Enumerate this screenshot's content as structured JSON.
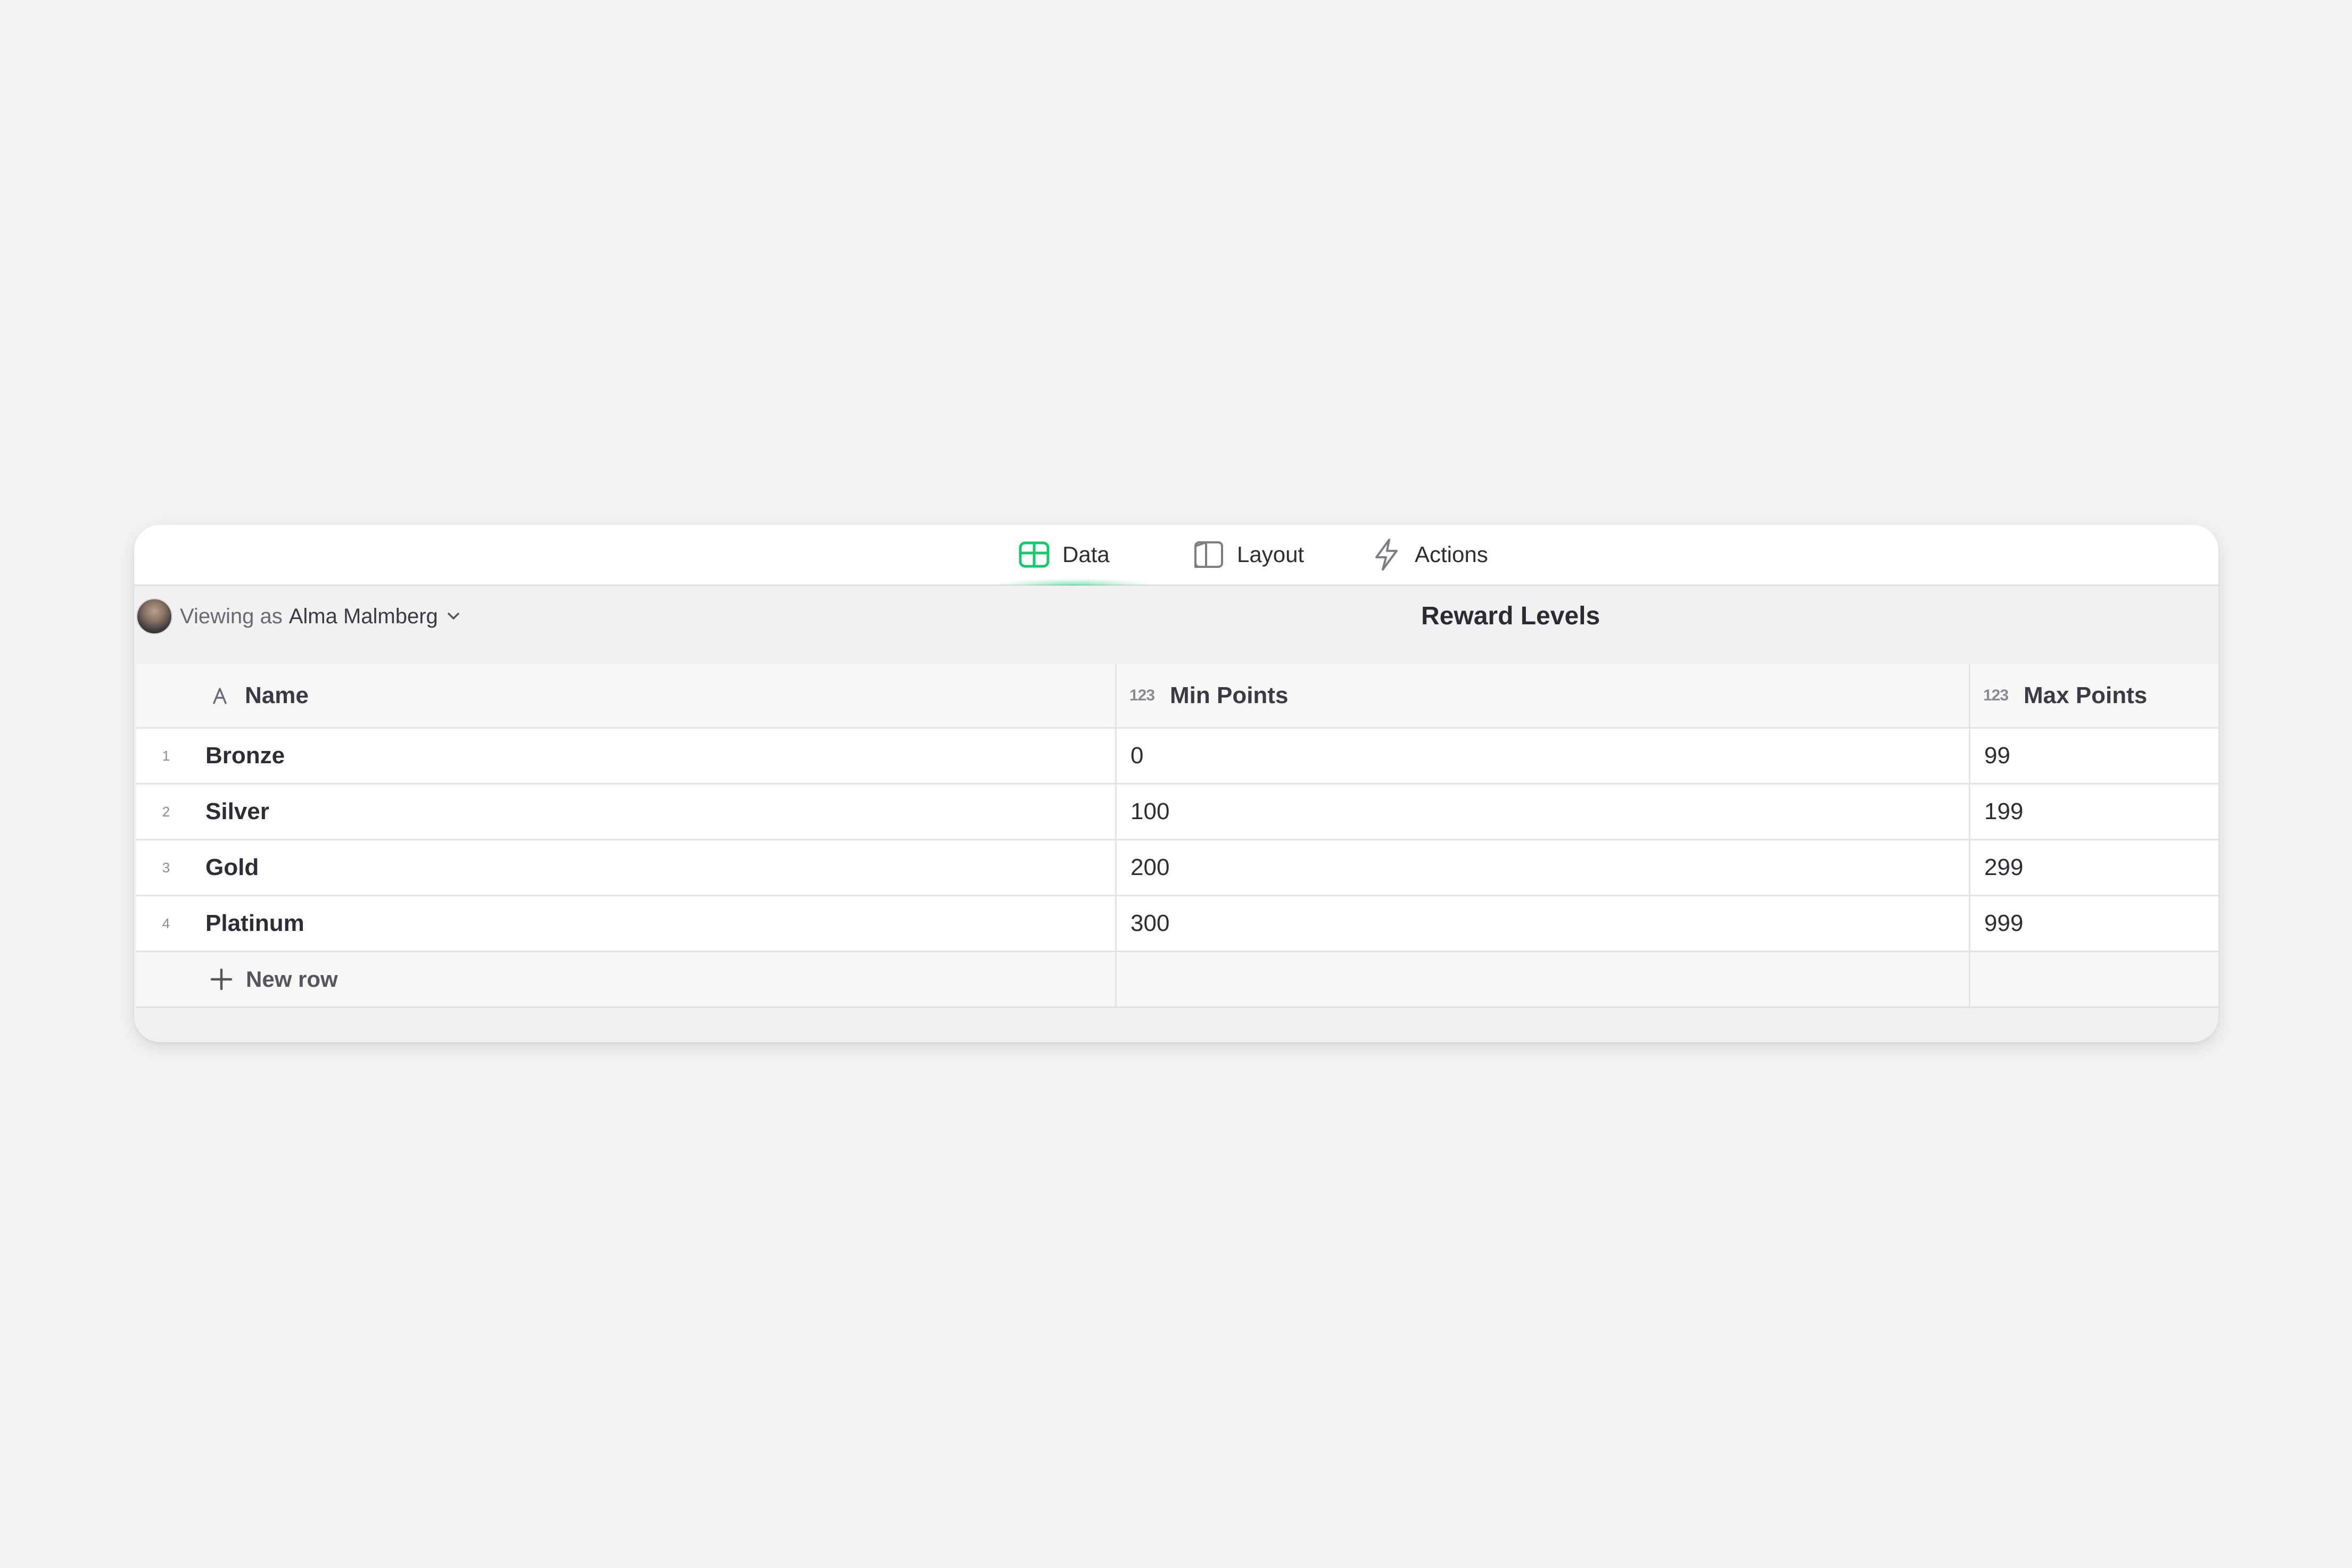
{
  "tabs": [
    {
      "label": "Data",
      "icon": "table-icon",
      "active": true
    },
    {
      "label": "Layout",
      "icon": "layout-icon",
      "active": false
    },
    {
      "label": "Actions",
      "icon": "lightning-icon",
      "active": false
    }
  ],
  "viewer": {
    "prefix": "Viewing as",
    "name": "Alma Malmberg"
  },
  "table": {
    "title": "Reward Levels",
    "columns": [
      {
        "label": "Name",
        "type_icon": "A"
      },
      {
        "label": "Min Points",
        "type_icon": "123"
      },
      {
        "label": "Max Points",
        "type_icon": "123"
      }
    ],
    "rows": [
      {
        "num": "1",
        "name": "Bronze",
        "min": "0",
        "max": "99"
      },
      {
        "num": "2",
        "name": "Silver",
        "min": "100",
        "max": "199"
      },
      {
        "num": "3",
        "name": "Gold",
        "min": "200",
        "max": "299"
      },
      {
        "num": "4",
        "name": "Platinum",
        "min": "300",
        "max": "999"
      }
    ],
    "new_row_label": "New row"
  },
  "colors": {
    "accent": "#14c96e",
    "background": "#f2f2f2",
    "text": "#2b2b33"
  }
}
